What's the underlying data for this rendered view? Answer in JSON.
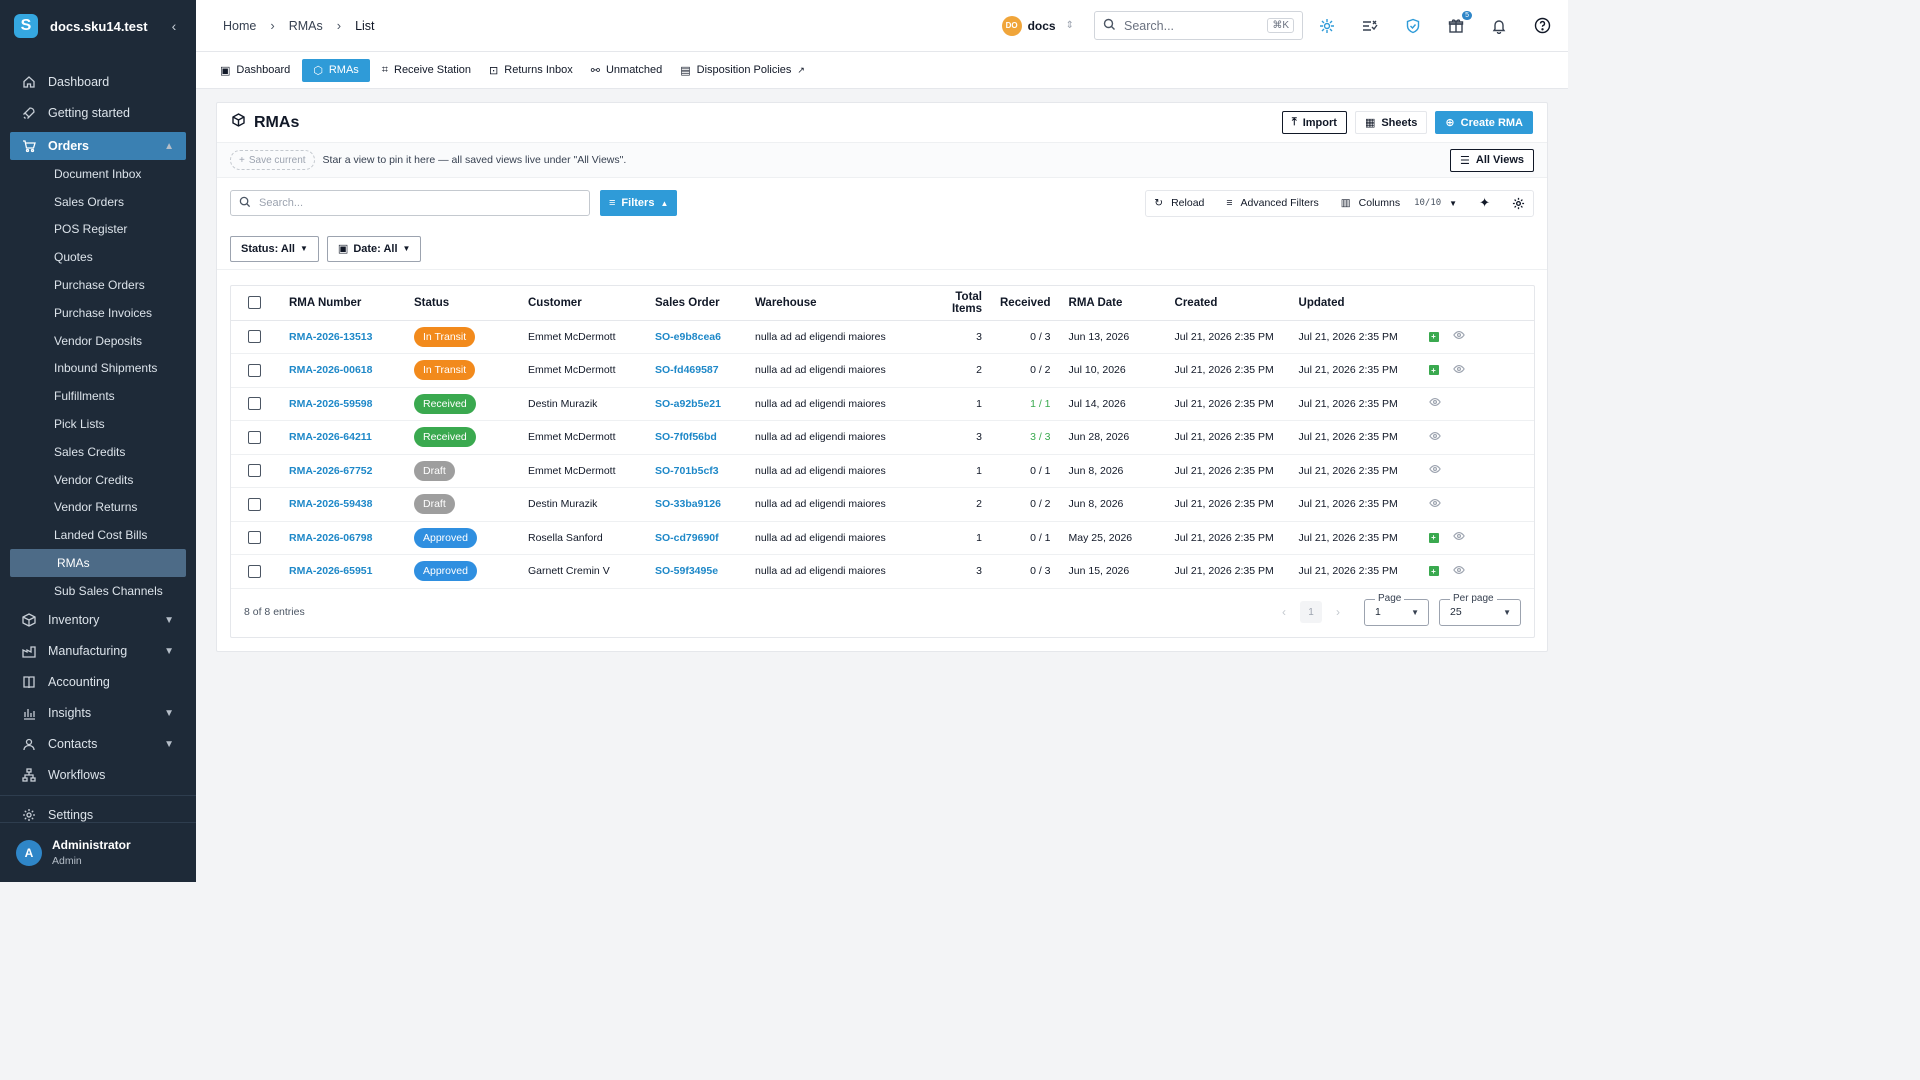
{
  "app": {
    "domain": "docs.sku14.test",
    "logo_letter": "S",
    "collapse_glyph": "‹"
  },
  "sidebar": {
    "items": [
      {
        "label": "Dashboard",
        "icon": "home-icon"
      },
      {
        "label": "Getting started",
        "icon": "rocket-icon"
      }
    ],
    "orders_group": {
      "label": "Orders",
      "icon": "cart-icon"
    },
    "orders_sub": [
      "Document Inbox",
      "Sales Orders",
      "POS Register",
      "Quotes",
      "Purchase Orders",
      "Purchase Invoices",
      "Vendor Deposits",
      "Inbound Shipments",
      "Fulfillments",
      "Pick Lists",
      "Sales Credits",
      "Vendor Credits",
      "Vendor Returns",
      "Landed Cost Bills",
      "RMAs",
      "Sub Sales Channels"
    ],
    "active_sub": "RMAs",
    "bottom_items": [
      {
        "label": "Inventory",
        "icon": "box-icon",
        "expandable": true
      },
      {
        "label": "Manufacturing",
        "icon": "factory-icon",
        "expandable": true
      },
      {
        "label": "Accounting",
        "icon": "book-icon",
        "expandable": false
      },
      {
        "label": "Insights",
        "icon": "bar-chart-icon",
        "expandable": true
      },
      {
        "label": "Contacts",
        "icon": "contacts-icon",
        "expandable": true
      },
      {
        "label": "Workflows",
        "icon": "workflow-icon",
        "expandable": false
      }
    ],
    "settings": {
      "label": "Settings",
      "icon": "gear-icon"
    },
    "user": {
      "initial": "A",
      "name": "Administrator",
      "role": "Admin"
    }
  },
  "topbar": {
    "breadcrumb": [
      "Home",
      "RMAs",
      "List"
    ],
    "workspace": {
      "initials": "DO",
      "name": "docs"
    },
    "search": {
      "placeholder": "Search...",
      "shortcut": "⌘K"
    },
    "gift_badge": "5"
  },
  "subtabs": [
    {
      "label": "Dashboard",
      "icon": "dashboard-icon"
    },
    {
      "label": "RMAs",
      "icon": "rma-icon",
      "active": true
    },
    {
      "label": "Receive Station",
      "icon": "scan-icon"
    },
    {
      "label": "Returns Inbox",
      "icon": "inbox-icon"
    },
    {
      "label": "Unmatched",
      "icon": "unlink-icon"
    },
    {
      "label": "Disposition Policies",
      "icon": "policy-icon",
      "external": true
    }
  ],
  "page": {
    "title": "RMAs",
    "buttons": {
      "import": "Import",
      "sheets": "Sheets",
      "create": "Create RMA",
      "all_views": "All Views"
    },
    "save_current": "Save current",
    "views_hint": "Star a view to pin it here — all saved views live under \"All Views\".",
    "search_placeholder": "Search...",
    "filters": "Filters",
    "toolbar": {
      "reload": "Reload",
      "advanced": "Advanced Filters",
      "columns": "Columns",
      "columns_count": "10/10"
    },
    "quick_filters": [
      "Status: All",
      "Date: All"
    ]
  },
  "table": {
    "columns": [
      "RMA Number",
      "Status",
      "Customer",
      "Sales Order",
      "Warehouse",
      "Total Items",
      "Received",
      "RMA Date",
      "Created",
      "Updated"
    ],
    "rows": [
      {
        "rma": "RMA-2026-13513",
        "status": "In Transit",
        "customer": "Emmet McDermott",
        "so": "SO-e9b8cea6",
        "warehouse": "nulla ad ad eligendi maiores",
        "total": "3",
        "received": "0 / 3",
        "received_complete": false,
        "date": "Jun 13, 2026",
        "created": "Jul 21, 2026 2:35 PM",
        "updated": "Jul 21, 2026 2:35 PM",
        "receive_action": true
      },
      {
        "rma": "RMA-2026-00618",
        "status": "In Transit",
        "customer": "Emmet McDermott",
        "so": "SO-fd469587",
        "warehouse": "nulla ad ad eligendi maiores",
        "total": "2",
        "received": "0 / 2",
        "received_complete": false,
        "date": "Jul 10, 2026",
        "created": "Jul 21, 2026 2:35 PM",
        "updated": "Jul 21, 2026 2:35 PM",
        "receive_action": true
      },
      {
        "rma": "RMA-2026-59598",
        "status": "Received",
        "customer": "Destin Murazik",
        "so": "SO-a92b5e21",
        "warehouse": "nulla ad ad eligendi maiores",
        "total": "1",
        "received": "1 / 1",
        "received_complete": true,
        "date": "Jul 14, 2026",
        "created": "Jul 21, 2026 2:35 PM",
        "updated": "Jul 21, 2026 2:35 PM",
        "receive_action": false
      },
      {
        "rma": "RMA-2026-64211",
        "status": "Received",
        "customer": "Emmet McDermott",
        "so": "SO-7f0f56bd",
        "warehouse": "nulla ad ad eligendi maiores",
        "total": "3",
        "received": "3 / 3",
        "received_complete": true,
        "date": "Jun 28, 2026",
        "created": "Jul 21, 2026 2:35 PM",
        "updated": "Jul 21, 2026 2:35 PM",
        "receive_action": false
      },
      {
        "rma": "RMA-2026-67752",
        "status": "Draft",
        "customer": "Emmet McDermott",
        "so": "SO-701b5cf3",
        "warehouse": "nulla ad ad eligendi maiores",
        "total": "1",
        "received": "0 / 1",
        "received_complete": false,
        "date": "Jun 8, 2026",
        "created": "Jul 21, 2026 2:35 PM",
        "updated": "Jul 21, 2026 2:35 PM",
        "receive_action": false
      },
      {
        "rma": "RMA-2026-59438",
        "status": "Draft",
        "customer": "Destin Murazik",
        "so": "SO-33ba9126",
        "warehouse": "nulla ad ad eligendi maiores",
        "total": "2",
        "received": "0 / 2",
        "received_complete": false,
        "date": "Jun 8, 2026",
        "created": "Jul 21, 2026 2:35 PM",
        "updated": "Jul 21, 2026 2:35 PM",
        "receive_action": false
      },
      {
        "rma": "RMA-2026-06798",
        "status": "Approved",
        "customer": "Rosella Sanford",
        "so": "SO-cd79690f",
        "warehouse": "nulla ad ad eligendi maiores",
        "total": "1",
        "received": "0 / 1",
        "received_complete": false,
        "date": "May 25, 2026",
        "created": "Jul 21, 2026 2:35 PM",
        "updated": "Jul 21, 2026 2:35 PM",
        "receive_action": true
      },
      {
        "rma": "RMA-2026-65951",
        "status": "Approved",
        "customer": "Garnett Cremin V",
        "so": "SO-59f3495e",
        "warehouse": "nulla ad ad eligendi maiores",
        "total": "3",
        "received": "0 / 3",
        "received_complete": false,
        "date": "Jun 15, 2026",
        "created": "Jul 21, 2026 2:35 PM",
        "updated": "Jul 21, 2026 2:35 PM",
        "receive_action": true
      }
    ],
    "status_colors": {
      "In Transit": "#f28a1c",
      "Received": "#3aa94f",
      "Draft": "#9e9e9e",
      "Approved": "#2f8fe0"
    },
    "received_complete_color": "#3aa94f",
    "footer": {
      "entries": "8 of 8 entries",
      "current_page": "1",
      "page_label": "Page",
      "page_value": "1",
      "per_page_label": "Per page",
      "per_page_value": "25"
    }
  }
}
